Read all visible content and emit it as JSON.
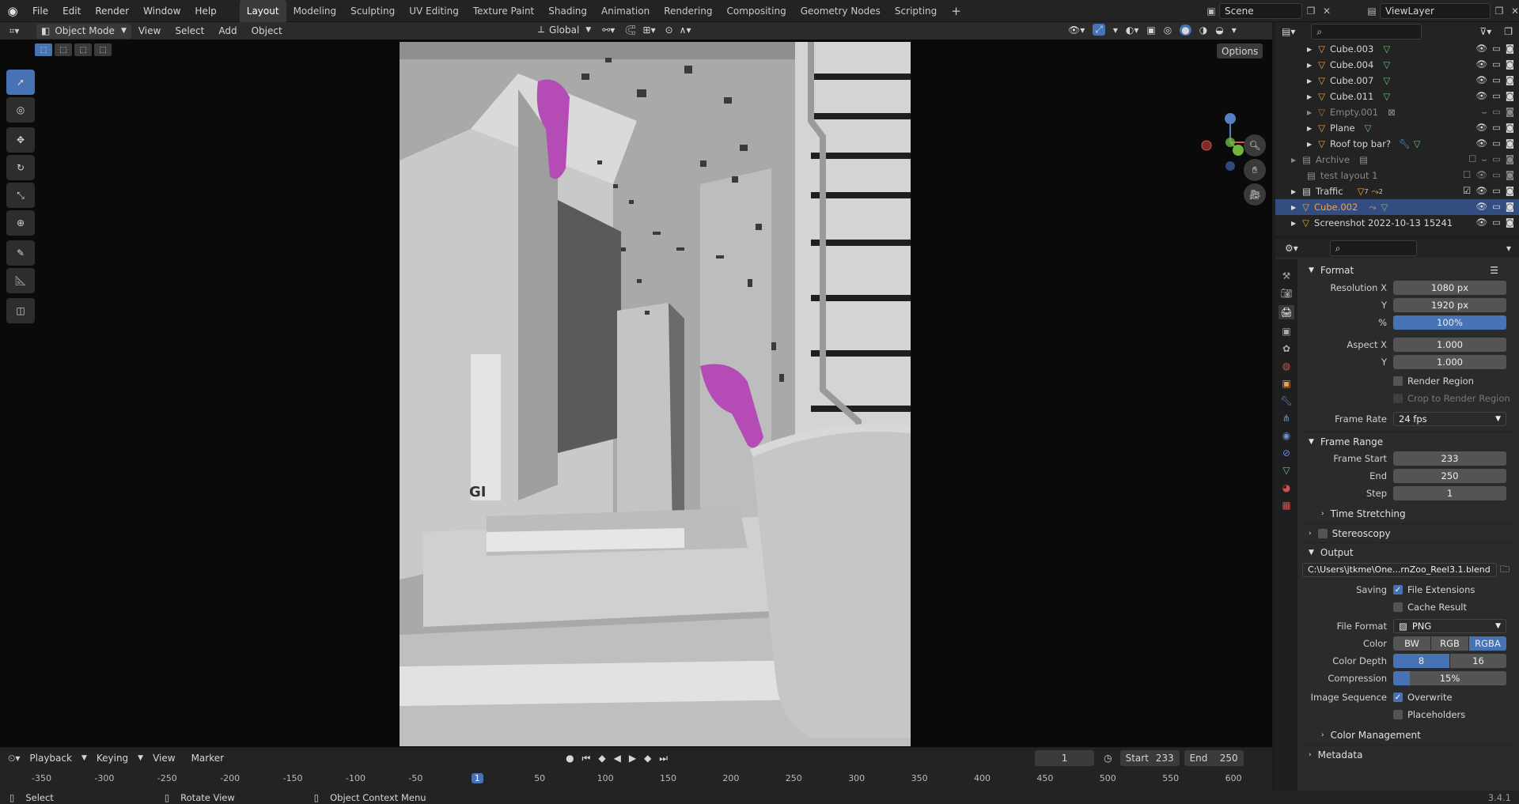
{
  "topbar": {
    "menus": [
      "File",
      "Edit",
      "Render",
      "Window",
      "Help"
    ],
    "workspaces": [
      "Layout",
      "Modeling",
      "Sculpting",
      "UV Editing",
      "Texture Paint",
      "Shading",
      "Animation",
      "Rendering",
      "Compositing",
      "Geometry Nodes",
      "Scripting"
    ],
    "active_workspace": "Layout",
    "add_tab": "+",
    "scene": "Scene",
    "view_layer": "ViewLayer"
  },
  "viewport_header": {
    "mode": "Object Mode",
    "menus": [
      "View",
      "Select",
      "Add",
      "Object"
    ],
    "orientation": "Global",
    "options": "Options"
  },
  "scene_text": {
    "sign": "GI"
  },
  "outliner": {
    "items": [
      {
        "label": "Cube.003",
        "icon": "mesh-object-icon",
        "dim": false
      },
      {
        "label": "Cube.004",
        "icon": "mesh-object-icon",
        "dim": false
      },
      {
        "label": "Cube.007",
        "icon": "mesh-object-icon",
        "dim": false
      },
      {
        "label": "Cube.011",
        "icon": "mesh-object-icon",
        "dim": false
      },
      {
        "label": "Empty.001",
        "icon": "empty-object-icon",
        "dim": true
      },
      {
        "label": "Plane",
        "icon": "mesh-object-icon",
        "dim": false
      },
      {
        "label": "Roof top bar?",
        "icon": "mesh-object-icon",
        "dim": false
      },
      {
        "label": "Archive",
        "icon": "collection-icon",
        "dim": true
      },
      {
        "label": "test layout 1",
        "icon": "collection-icon",
        "dim": true
      },
      {
        "label": "Traffic",
        "icon": "collection-icon",
        "dim": false
      },
      {
        "label": "Cube.002",
        "icon": "mesh-object-icon",
        "dim": false,
        "selected": true
      },
      {
        "label": "Screenshot 2022-10-13 15241",
        "icon": "image-object-icon",
        "dim": false
      }
    ],
    "traffic_counts": [
      "7",
      "2"
    ]
  },
  "properties": {
    "format": {
      "title": "Format",
      "resolution_x_label": "Resolution X",
      "resolution_x": "1080 px",
      "resolution_y_label": "Y",
      "resolution_y": "1920 px",
      "percent_label": "%",
      "percent": "100%",
      "aspect_x_label": "Aspect X",
      "aspect_x": "1.000",
      "aspect_y_label": "Y",
      "aspect_y": "1.000",
      "render_region": "Render Region",
      "crop_region": "Crop to Render Region",
      "frame_rate_label": "Frame Rate",
      "frame_rate": "24 fps"
    },
    "frame_range": {
      "title": "Frame Range",
      "start_label": "Frame Start",
      "start": "233",
      "end_label": "End",
      "end": "250",
      "step_label": "Step",
      "step": "1",
      "time_stretching": "Time Stretching"
    },
    "stereoscopy": "Stereoscopy",
    "output": {
      "title": "Output",
      "path": "C:\\Users\\jtkme\\One...rnZoo_Reel3.1.blend",
      "saving_label": "Saving",
      "file_extensions": "File Extensions",
      "cache_result": "Cache Result",
      "file_format_label": "File Format",
      "file_format": "PNG",
      "color_label": "Color",
      "color_options": [
        "BW",
        "RGB",
        "RGBA"
      ],
      "color_selected": "RGBA",
      "color_depth_label": "Color Depth",
      "depth_options": [
        "8",
        "16"
      ],
      "depth_selected": "8",
      "compression_label": "Compression",
      "compression": "15%",
      "compression_level": 0.15,
      "image_sequence_label": "Image Sequence",
      "overwrite": "Overwrite",
      "placeholders": "Placeholders",
      "color_management": "Color Management"
    },
    "metadata": "Metadata"
  },
  "timeline": {
    "menus": [
      "Playback",
      "Keying",
      "View",
      "Marker"
    ],
    "current_frame": "1",
    "start_label": "Start",
    "start": "233",
    "end_label": "End",
    "end": "250",
    "ticks": [
      "-350",
      "-300",
      "-250",
      "-200",
      "-150",
      "-100",
      "-50",
      "1",
      "50",
      "100",
      "150",
      "200",
      "250",
      "300",
      "350",
      "400",
      "450",
      "500",
      "550",
      "600"
    ]
  },
  "statusbar": {
    "select": "Select",
    "rotate": "Rotate View",
    "context": "Object Context Menu",
    "version": "3.4.1"
  },
  "colors": {
    "accent": "#4772b3",
    "selection": "#334d80",
    "magenta": "#b54bb4"
  }
}
